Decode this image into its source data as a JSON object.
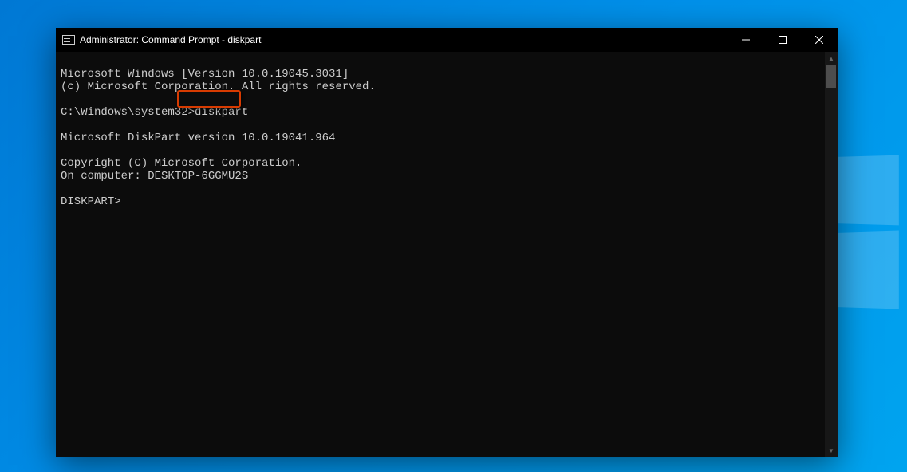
{
  "window": {
    "title": "Administrator: Command Prompt - diskpart"
  },
  "terminal": {
    "lines": [
      "Microsoft Windows [Version 10.0.19045.3031]",
      "(c) Microsoft Corporation. All rights reserved.",
      "",
      "C:\\Windows\\system32>diskpart",
      "",
      "Microsoft DiskPart version 10.0.19041.964",
      "",
      "Copyright (C) Microsoft Corporation.",
      "On computer: DESKTOP-6GGMU2S",
      "",
      "DISKPART>"
    ],
    "prompt_path": "C:\\Windows\\system32>",
    "command_entered": "diskpart",
    "highlight": {
      "text": "diskpart",
      "line_index": 3
    }
  }
}
